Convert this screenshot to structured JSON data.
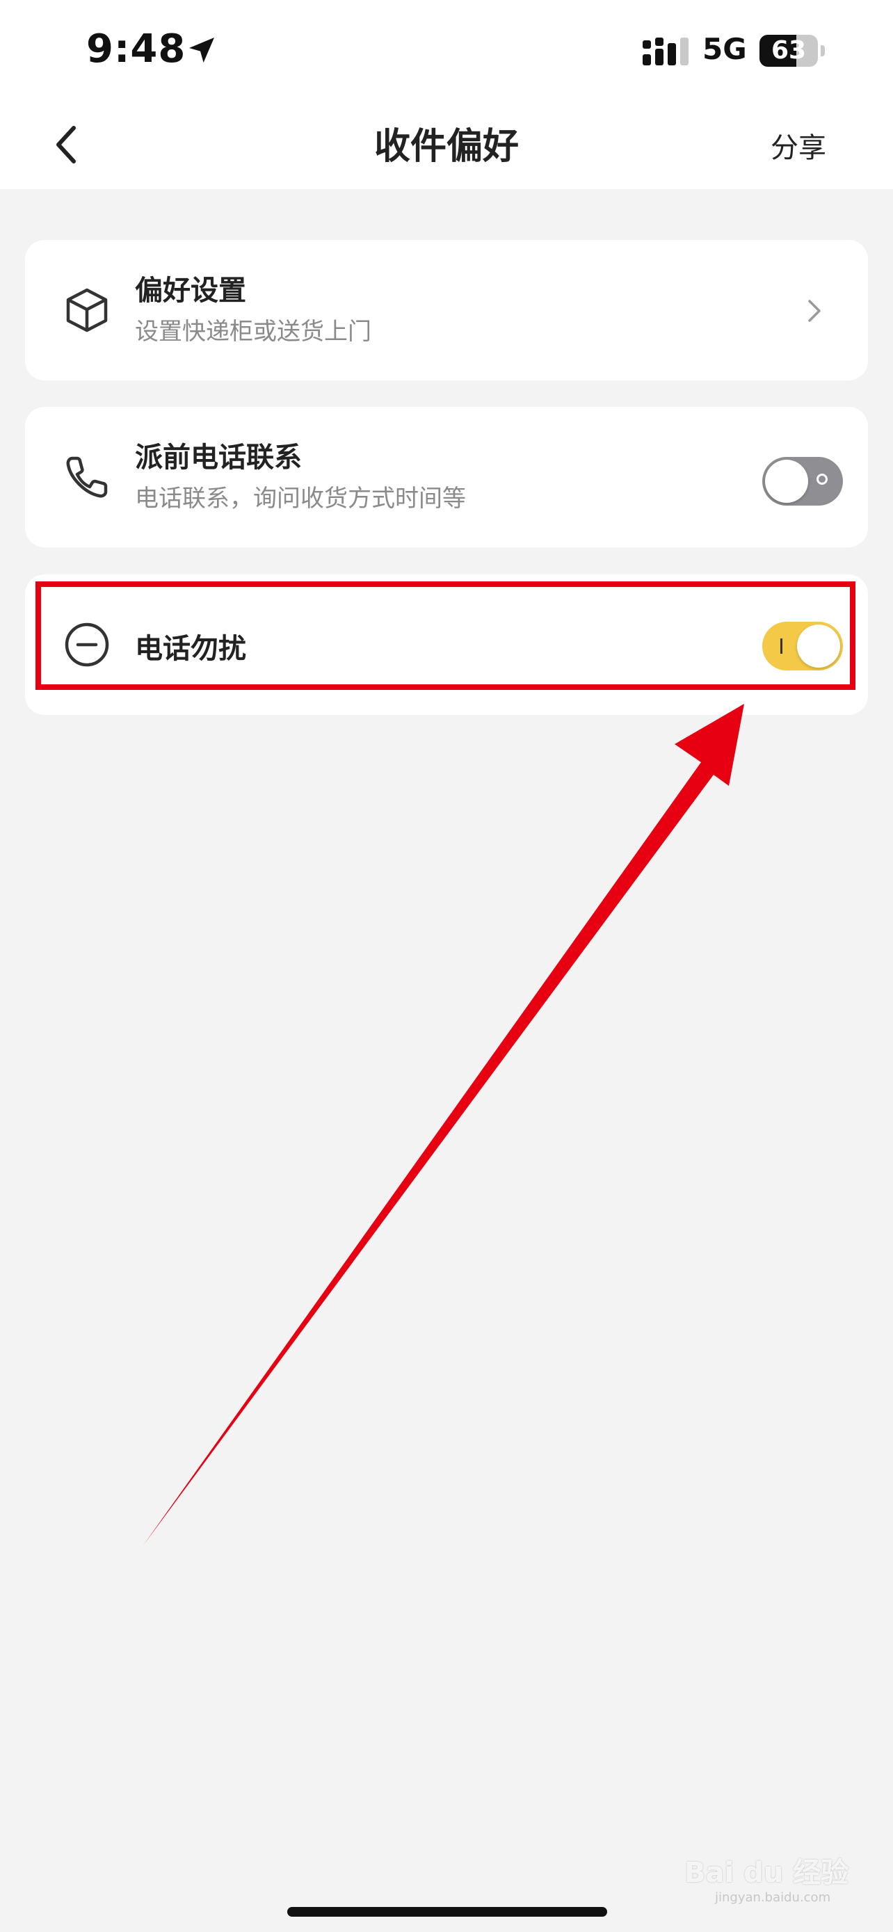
{
  "status_bar": {
    "time": "9:48",
    "network": "5G",
    "battery": "63",
    "battery_level": 0.63,
    "location_icon": "location-arrow-icon",
    "signal_icon": "cellular-signal-icon"
  },
  "nav": {
    "title": "收件偏好",
    "share_label": "分享",
    "back_icon": "chevron-left-icon"
  },
  "items": [
    {
      "title": "偏好设置",
      "subtitle": "设置快递柜或送货上门",
      "icon": "package-box-icon",
      "control": "chevron-right-icon"
    },
    {
      "title": "派前电话联系",
      "subtitle": "电话联系，询问收货方式时间等",
      "icon": "phone-icon",
      "control": "toggle",
      "enabled": false
    },
    {
      "title": "电话勿扰",
      "icon": "do-not-disturb-icon",
      "control": "toggle",
      "enabled": true
    }
  ],
  "annotation": {
    "highlight_color": "#e60012"
  },
  "colors": {
    "toggle_on": "#f4c947",
    "toggle_off": "#8e8e93",
    "background": "#f3f3f3"
  },
  "watermark": {
    "brand": "Bai du 经验",
    "domain": "jingyan.baidu.com"
  }
}
